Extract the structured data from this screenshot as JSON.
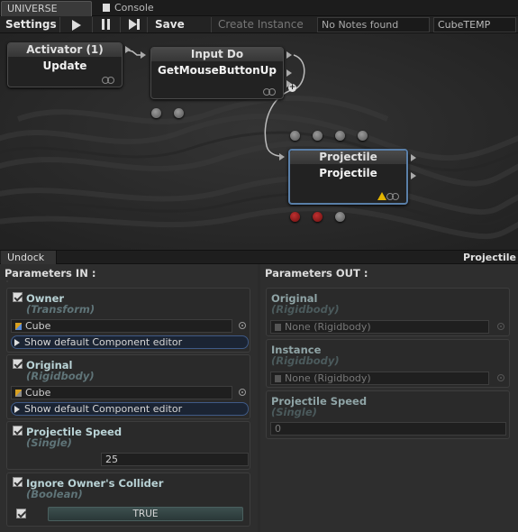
{
  "tabs": [
    {
      "label": "UNIVERSE"
    },
    {
      "label": "Console"
    }
  ],
  "toolbar": {
    "settings_label": "Settings",
    "save_label": "Save",
    "create_instance_label": "Create Instance",
    "notes_value": "No Notes found",
    "graph_name": "CubeTEMP"
  },
  "graph": {
    "nodes": [
      {
        "title": "Activator (1)",
        "body": "Update"
      },
      {
        "title": "Input Do",
        "body": "GetMouseButtonUp"
      },
      {
        "title": "Projectile",
        "body": "Projectile"
      }
    ]
  },
  "dock": {
    "undock_label": "Undock",
    "title": "Projectile"
  },
  "params_in": {
    "header": "Parameters IN :",
    "owner": {
      "name": "Owner",
      "type": "(Transform)",
      "value": "Cube",
      "editor_label": "Show default Component editor"
    },
    "original": {
      "name": "Original",
      "type": "(Rigidbody)",
      "value": "Cube",
      "editor_label": "Show default Component editor"
    },
    "speed": {
      "name": "Projectile Speed",
      "type": "(Single)",
      "value": "25"
    },
    "ignore": {
      "name": "Ignore Owner's Collider",
      "type": "(Boolean)",
      "value": "TRUE"
    }
  },
  "params_out": {
    "header": "Parameters OUT :",
    "original": {
      "name": "Original",
      "type": "(Rigidbody)",
      "value": "None (Rigidbody)"
    },
    "instance": {
      "name": "Instance",
      "type": "(Rigidbody)",
      "value": "None (Rigidbody)"
    },
    "speed": {
      "name": "Projectile Speed",
      "type": "(Single)",
      "value": "0"
    }
  },
  "colors": {
    "accent_blue": "#5a7fa8",
    "param_name": "#b9d3d6",
    "param_type": "#5f7478",
    "warning": "#e2b400",
    "red_pin": "#c03030"
  }
}
